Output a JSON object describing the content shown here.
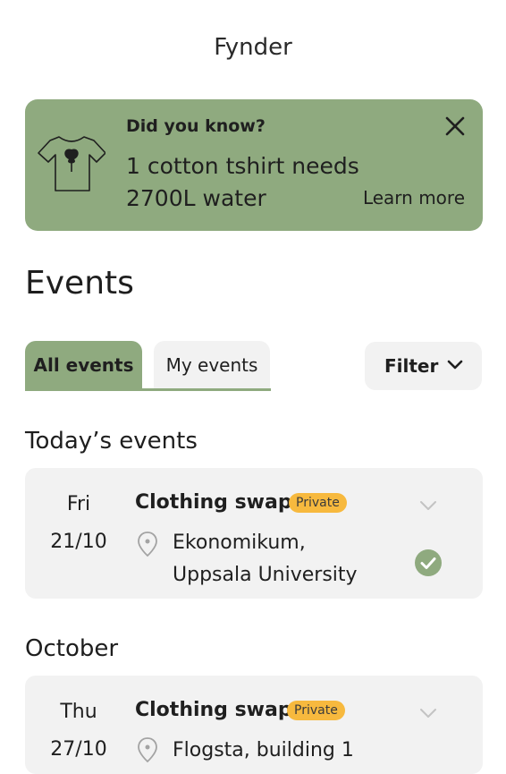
{
  "app": {
    "title": "Fynder"
  },
  "banner": {
    "icon": "tshirt-icon",
    "heading": "Did you know?",
    "line1": "1 cotton tshirt needs",
    "line2": "2700L water",
    "learn_more": "Learn more",
    "close_icon": "close-icon",
    "background": "#8faa7f"
  },
  "events": {
    "heading": "Events",
    "tabs": [
      {
        "label": "All events",
        "selected": true
      },
      {
        "label": "My events",
        "selected": false
      }
    ],
    "filter_label": "Filter",
    "sections": [
      {
        "label": "Today’s events",
        "items": [
          {
            "day": "Fri",
            "date": "21/10",
            "title": "Clothing swap",
            "badge": "Private",
            "location_line1": "Ekonomikum,",
            "location_line2": "Uppsala University",
            "joined": true
          }
        ]
      },
      {
        "label": "October",
        "items": [
          {
            "day": "Thu",
            "date": "27/10",
            "title": "Clothing swap",
            "badge": "Private",
            "location_line1": "Flogsta, building 1"
          }
        ]
      }
    ]
  },
  "colors": {
    "accent": "#8faa7f",
    "badge": "#f7b93e",
    "card": "#f2f2f2"
  }
}
